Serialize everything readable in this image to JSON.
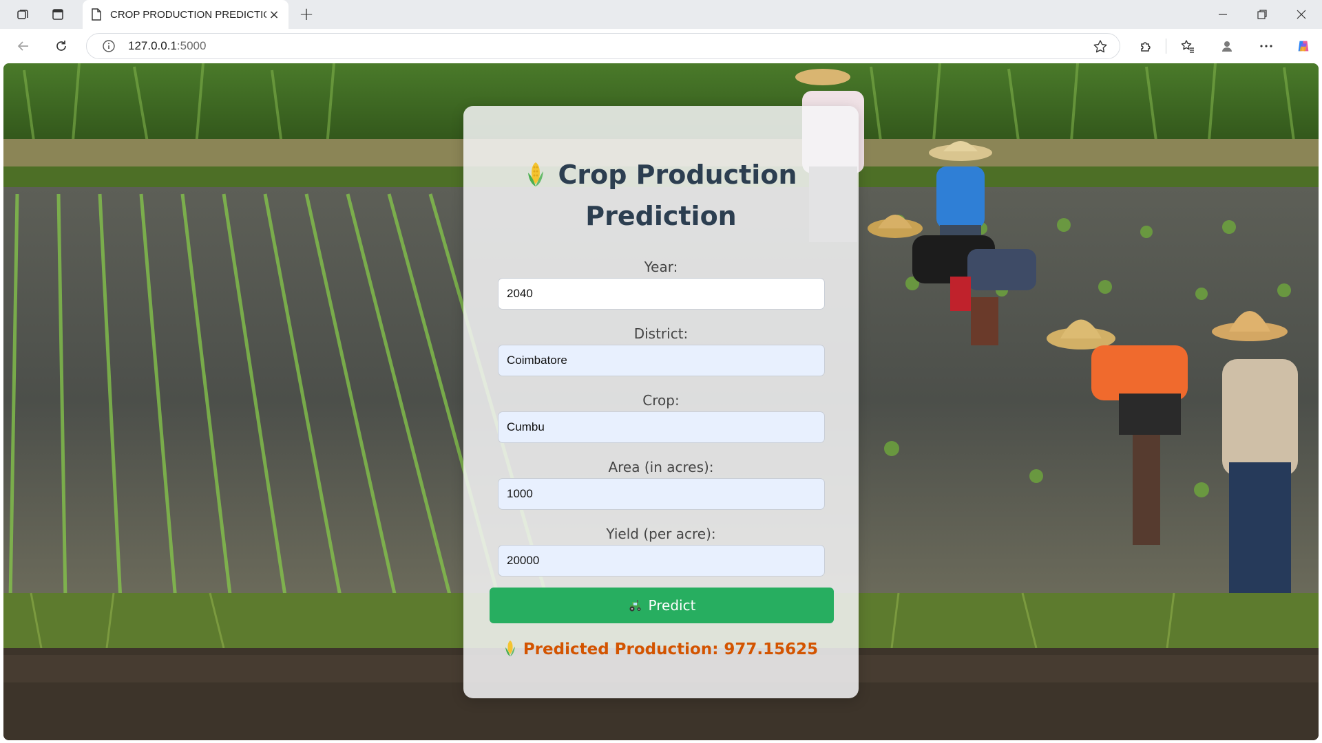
{
  "browser": {
    "tab_title": "CROP PRODUCTION PREDICTION",
    "tab_close": "×",
    "new_tab": "+",
    "url_host": "127.0.0.1",
    "url_port": ":5000"
  },
  "icons": {
    "workspaces": "workspaces-icon",
    "tab_actions": "tab-actions-icon",
    "page": "page-icon",
    "back": "back-arrow-icon",
    "reload": "reload-icon",
    "info": "info-icon",
    "favorite": "star-icon",
    "extensions": "puzzle-icon",
    "favorites": "favorites-icon",
    "profile": "profile-icon",
    "more": "more-icon",
    "copilot": "copilot-icon",
    "title_emoji": "corn-icon",
    "button_emoji": "tractor-icon",
    "result_emoji": "corn-icon"
  },
  "form": {
    "title": "Crop Production Prediction",
    "fields": [
      {
        "label": "Year:",
        "value": "2040"
      },
      {
        "label": "District:",
        "value": "Coimbatore"
      },
      {
        "label": "Crop:",
        "value": "Cumbu"
      },
      {
        "label": "Area (in acres):",
        "value": "1000"
      },
      {
        "label": "Yield (per acre):",
        "value": "20000"
      }
    ],
    "predict_label": "Predict",
    "result_text": "Predicted Production: 977.15625"
  },
  "colors": {
    "title": "#2c3e50",
    "button": "#27ae60",
    "result": "#d35400",
    "autofill_input": "#e8f0fe"
  }
}
